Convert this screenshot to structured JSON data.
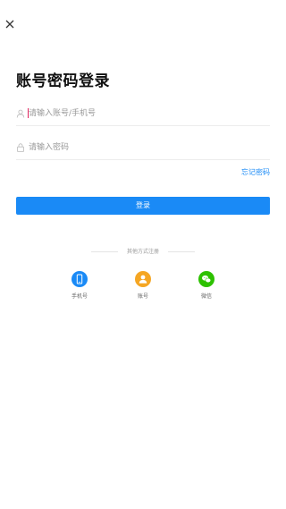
{
  "header": {
    "close_icon": "close-icon"
  },
  "title": "账号密码登录",
  "form": {
    "account_placeholder": "请输入账号/手机号",
    "account_value": "",
    "account_icon": "user-icon",
    "password_placeholder": "请输入密码",
    "password_value": "",
    "password_icon": "lock-icon",
    "forgot_label": "忘记密码",
    "login_label": "登录"
  },
  "other_methods": {
    "divider_label": "其他方式注册",
    "items": [
      {
        "label": "手机号",
        "icon": "phone-icon",
        "color": "#1a8af6"
      },
      {
        "label": "账号",
        "icon": "person-icon",
        "color": "#f5a623"
      },
      {
        "label": "微信",
        "icon": "wechat-icon",
        "color": "#2dc100"
      }
    ]
  },
  "colors": {
    "accent": "#1a8af6",
    "caret": "#e0245e"
  }
}
